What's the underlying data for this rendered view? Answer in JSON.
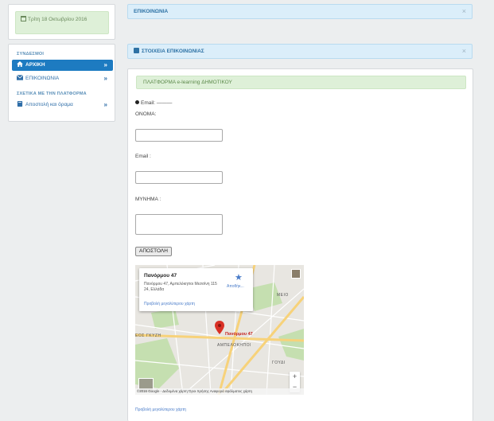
{
  "date": {
    "text": "Τρίτη 18 Οκτωβρίου 2016"
  },
  "sidebar": {
    "section_links": "ΣΥΝΔΕΣΜΟΙ",
    "items": [
      {
        "label": "ΑΡΧΙΚΗ",
        "icon": "home-icon",
        "active": true
      },
      {
        "label": "ΕΠΙΚΟΙΝΩΝΙΑ",
        "icon": "envelope-icon",
        "active": false
      }
    ],
    "section_about": "ΣΧΕΤΙΚΑ ΜΕ ΤΗΝ ΠΛΑΤΦΟΡΜΑ",
    "about_items": [
      {
        "label": "Αποστολή και όραμα",
        "icon": "book-icon"
      }
    ]
  },
  "header": {
    "title": "ΕΠΙΚΟΙΝΩΝΙΑ",
    "close": "×"
  },
  "contact_header": {
    "title": "ΣΤΟΙΧΕΙΑ ΕΠΙΚΟΙΝΩΝΙΑΣ",
    "close": "×"
  },
  "content": {
    "platform_title": "ΠΛΑΤΦΟΡΜΑ e-learning ΔΗΜΟΤΙΚΟΥ",
    "email_line": "Email: ———",
    "name_label": "ΟΝΟΜΑ:",
    "email_label": "Email :",
    "message_label": "ΜΥΝΗΜΑ :",
    "send_button": "ΑΠΟΣΤΟΛΗ"
  },
  "map": {
    "place_name": "Πανόρμου 47",
    "address": "Πανόρμου 47, Αμπελόκηποι Μεσσίνη 115 24, Ελλάδα",
    "save_label": "Αποθήκ...",
    "bigger_map": "Προβολή μεγαλύτερου χάρτη",
    "pin_label": "Πανόρμου 47",
    "streets": [
      "ΜΕΙΟ",
      "ΓΚΥΖΗ",
      "ΑΜΠΕΛΟΚΗΠΟΙ",
      "ΓΟΥΔΙ",
      "ΕΟΣ"
    ],
    "footer": "©2016 Google - Δεδομένα χάρτη    Όροι Χρήσης    Αναφορά σφάλματος χάρτη",
    "zoom_in": "+",
    "zoom_out": "−",
    "link_below": "Προβολή μεγαλύτερου χάρτη"
  },
  "colors": {
    "accent": "#1d7bc1",
    "bar_bg": "#dbeefa",
    "success_bg": "#def0d8",
    "pin": "#c5221f"
  }
}
